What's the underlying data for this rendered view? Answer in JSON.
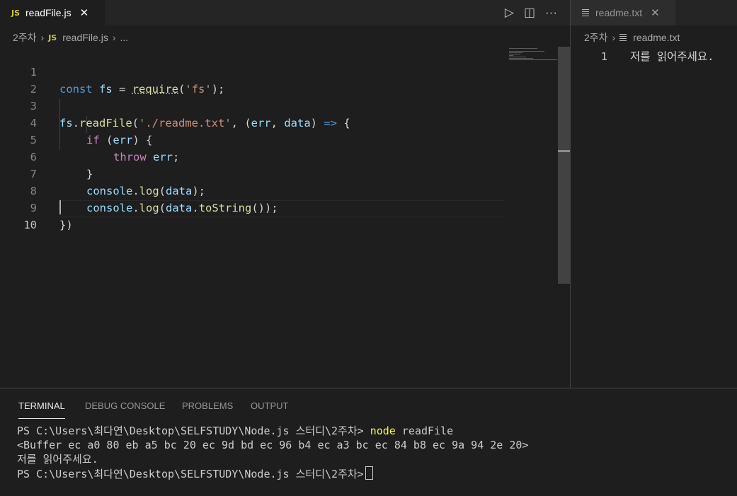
{
  "left_tab": {
    "badge": "JS",
    "label": "readFile.js",
    "close": "✕"
  },
  "right_tab": {
    "label": "readme.txt",
    "close": "✕"
  },
  "editor_actions": {
    "run": "▷",
    "split": "◫",
    "more": "···"
  },
  "breadcrumb_left": {
    "folder": "2주차",
    "sep": "›",
    "badge": "JS",
    "file": "readFile.js",
    "sep2": "›",
    "more": "..."
  },
  "breadcrumb_right": {
    "folder": "2주차",
    "sep": "›",
    "file": "readme.txt"
  },
  "code": {
    "line_numbers": [
      "1",
      "2",
      "3",
      "4",
      "5",
      "6",
      "7",
      "8",
      "9",
      "10"
    ],
    "l1": {
      "const": "const",
      "fs": "fs",
      "eq": " = ",
      "req": "require",
      "p1": "(",
      "str": "'fs'",
      "p2": ");"
    },
    "l3": {
      "fs": "fs",
      "dot": ".",
      "readFile": "readFile",
      "p1": "(",
      "str": "'./readme.txt'",
      "c1": ", (",
      "err": "err",
      "c2": ", ",
      "data": "data",
      "c3": ") ",
      "arrow": "=>",
      "c4": " {"
    },
    "l4": {
      "if": "if",
      "p1": " (",
      "err": "err",
      "p2": ") {"
    },
    "l5": {
      "throw": "throw",
      "sp": " ",
      "err": "err",
      "semi": ";"
    },
    "l6": {
      "brace": "}"
    },
    "l7": {
      "console": "console",
      "dot": ".",
      "log": "log",
      "p1": "(",
      "data": "data",
      "p2": ");"
    },
    "l8": {
      "console": "console",
      "dot": ".",
      "log": "log",
      "p1": "(",
      "data": "data",
      "dot2": ".",
      "toString": "toString",
      "p2": "());"
    },
    "l9": {
      "close": "})"
    }
  },
  "readme": {
    "line_number": "1",
    "text": "저를 읽어주세요."
  },
  "panel": {
    "tabs": [
      "TERMINAL",
      "DEBUG CONSOLE",
      "PROBLEMS",
      "OUTPUT"
    ]
  },
  "terminal": {
    "prompt1": "PS C:\\Users\\최다연\\Desktop\\SELFSTUDY\\Node.js 스터디\\2주차> ",
    "cmd": "node",
    "args": " readFile",
    "buffer": "<Buffer ec a0 80 eb a5 bc 20 ec 9d bd ec 96 b4 ec a3 bc ec 84 b8 ec 9a 94 2e 20>",
    "output": "저를 읽어주세요.",
    "prompt2": "PS C:\\Users\\최다연\\Desktop\\SELFSTUDY\\Node.js 스터디\\2주차>"
  },
  "colors": {
    "background": "#1e1e1e",
    "keyword": "#569cd6",
    "control": "#c586c0",
    "variable": "#9cdcfe",
    "function": "#dcdcaa",
    "string": "#ce9178",
    "terminal_command": "#f5f543"
  }
}
